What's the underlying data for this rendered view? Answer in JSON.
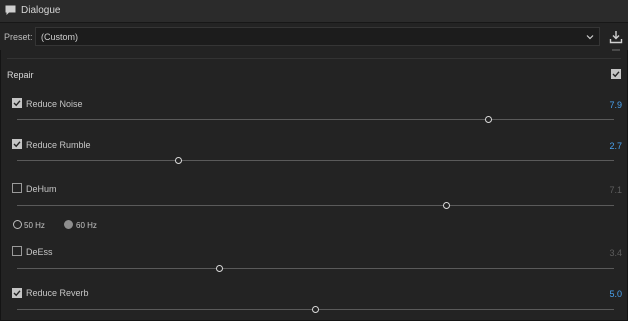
{
  "panel": {
    "title": "Dialogue"
  },
  "preset": {
    "label": "Preset:",
    "value": "(Custom)"
  },
  "section": {
    "title": "Repair",
    "enabled": true
  },
  "effects": {
    "reduce_noise": {
      "label": "Reduce Noise",
      "checked": true,
      "value": "7.9",
      "level": 0.79
    },
    "reduce_rumble": {
      "label": "Reduce Rumble",
      "checked": true,
      "value": "2.7",
      "level": 0.27
    },
    "dehum": {
      "label": "DeHum",
      "checked": false,
      "value": "7.1",
      "level": 0.72
    },
    "deess": {
      "label": "DeEss",
      "checked": false,
      "value": "3.4",
      "level": 0.34
    },
    "reduce_reverb": {
      "label": "Reduce Reverb",
      "checked": true,
      "value": "5.0",
      "level": 0.5
    }
  },
  "dehum_freq": {
    "options": [
      "50 Hz",
      "60 Hz"
    ],
    "selected": "60 Hz"
  },
  "colors": {
    "active_value": "#4aa3f0",
    "inactive_value": "#5e5e5e",
    "background": "#232323"
  }
}
